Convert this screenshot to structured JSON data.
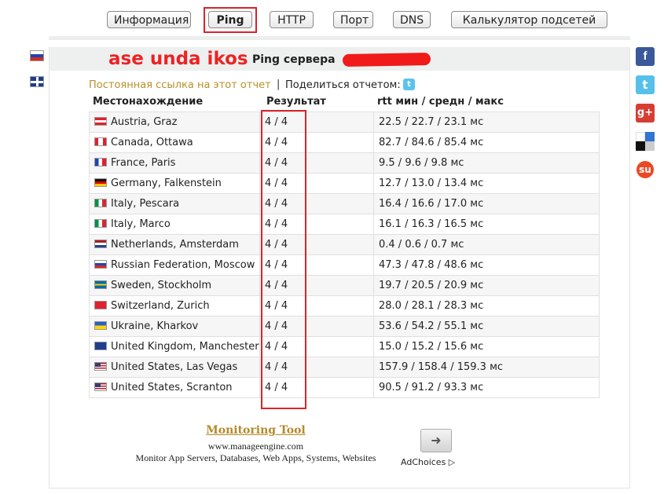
{
  "tabs": [
    {
      "label": "Информация",
      "active": false
    },
    {
      "label": "Ping",
      "active": true
    },
    {
      "label": "HTTP",
      "active": false
    },
    {
      "label": "Порт",
      "active": false
    },
    {
      "label": "DNS",
      "active": false
    },
    {
      "label": "Калькулятор подсетей",
      "active": false
    }
  ],
  "annotation": "ase unda ikos",
  "report": {
    "title": "Ping сервера",
    "permalink": "Постоянная ссылка на этот отчет",
    "separator": "|",
    "share": "Поделиться отчетом:"
  },
  "table": {
    "headers": {
      "location": "Местонахождение",
      "result": "Результат",
      "rtt": "rtt мин / средн / макс"
    },
    "rows": [
      {
        "flag": "at",
        "location": "Austria, Graz",
        "result": "4 / 4",
        "rtt": "22.5 / 22.7 / 23.1 мс"
      },
      {
        "flag": "ca",
        "location": "Canada, Ottawa",
        "result": "4 / 4",
        "rtt": "82.7 / 84.6 / 85.4 мс"
      },
      {
        "flag": "fr",
        "location": "France, Paris",
        "result": "4 / 4",
        "rtt": "9.5 / 9.6 / 9.8 мс"
      },
      {
        "flag": "de",
        "location": "Germany, Falkenstein",
        "result": "4 / 4",
        "rtt": "12.7 / 13.0 / 13.4 мс"
      },
      {
        "flag": "it",
        "location": "Italy, Pescara",
        "result": "4 / 4",
        "rtt": "16.4 / 16.6 / 17.0 мс"
      },
      {
        "flag": "it",
        "location": "Italy, Marco",
        "result": "4 / 4",
        "rtt": "16.1 / 16.3 / 16.5 мс"
      },
      {
        "flag": "nl",
        "location": "Netherlands, Amsterdam",
        "result": "4 / 4",
        "rtt": "0.4 / 0.6 / 0.7 мс"
      },
      {
        "flag": "ru",
        "location": "Russian Federation, Moscow",
        "result": "4 / 4",
        "rtt": "47.3 / 47.8 / 48.6 мс"
      },
      {
        "flag": "se",
        "location": "Sweden, Stockholm",
        "result": "4 / 4",
        "rtt": "19.7 / 20.5 / 20.9 мс"
      },
      {
        "flag": "ch",
        "location": "Switzerland, Zurich",
        "result": "4 / 4",
        "rtt": "28.0 / 28.1 / 28.3 мс"
      },
      {
        "flag": "ua",
        "location": "Ukraine, Kharkov",
        "result": "4 / 4",
        "rtt": "53.6 / 54.2 / 55.1 мс"
      },
      {
        "flag": "gb",
        "location": "United Kingdom, Manchester",
        "result": "4 / 4",
        "rtt": "15.0 / 15.2 / 15.6 мс"
      },
      {
        "flag": "us",
        "location": "United States, Las Vegas",
        "result": "4 / 4",
        "rtt": "157.9 / 158.4 / 159.3 мс"
      },
      {
        "flag": "us",
        "location": "United States, Scranton",
        "result": "4 / 4",
        "rtt": "90.5 / 91.2 / 93.3 мс"
      }
    ]
  },
  "ad": {
    "title": "Monitoring Tool",
    "url": "www.manageengine.com",
    "text": "Monitor App Servers, Databases, Web Apps, Systems, Websites",
    "adchoices": "AdChoices",
    "arrow_icon": "arrow-right-icon"
  },
  "language_flags": [
    "russia-flag-icon",
    "uk-flag-icon"
  ],
  "social_icons": [
    "facebook-icon",
    "twitter-icon",
    "google-plus-icon",
    "delicious-icon",
    "stumbleupon-icon"
  ],
  "colors": {
    "highlight": "#d9242b",
    "annotation": "#ee2222",
    "permalink": "#b9902a",
    "ad_title": "#b48a2a"
  }
}
